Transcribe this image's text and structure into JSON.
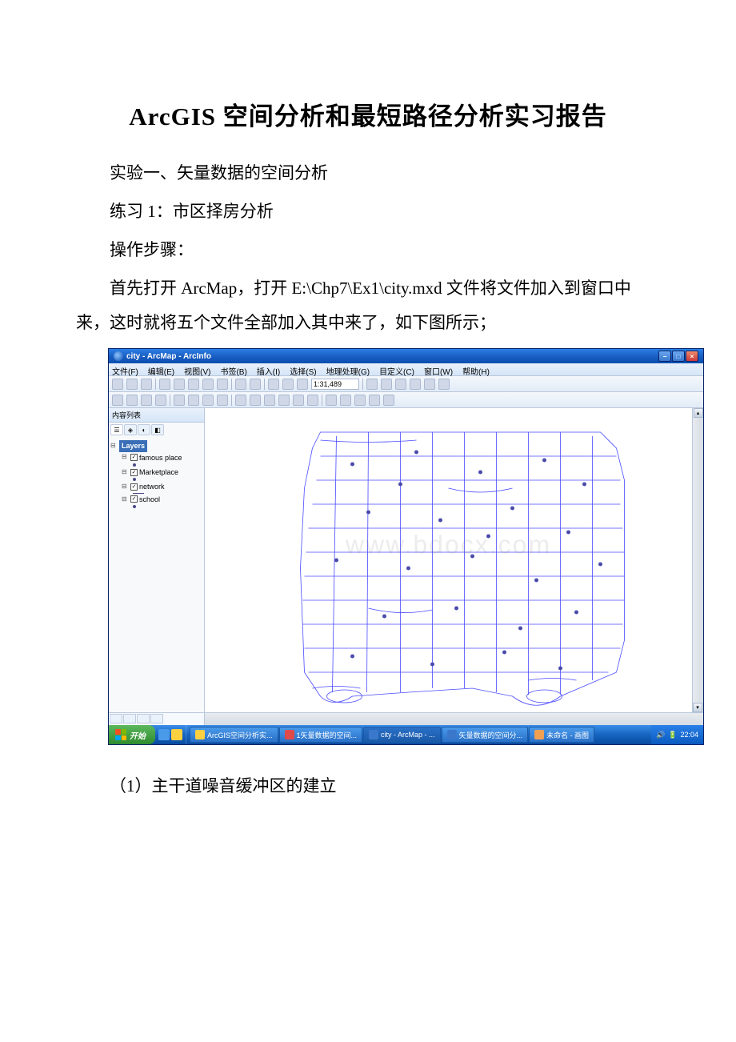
{
  "doc": {
    "title": "ArcGIS 空间分析和最短路径分析实习报告",
    "p1": "实验一、矢量数据的空间分析",
    "p2": "练习 1：市区择房分析",
    "p3": "操作步骤：",
    "p4": "首先打开 ArcMap，打开 E:\\Chp7\\Ex1\\city.mxd 文件将文件加入到窗口中来，这时就将五个文件全部加入其中来了，如下图所示；",
    "p5": "（1）主干道噪音缓冲区的建立"
  },
  "window": {
    "title": "city - ArcMap - ArcInfo",
    "min": "−",
    "max": "□",
    "close": "×"
  },
  "menubar": {
    "items": [
      "文件(F)",
      "编辑(E)",
      "视图(V)",
      "书签(B)",
      "插入(I)",
      "选择(S)",
      "地理处理(G)",
      "目定义(C)",
      "窗口(W)",
      "帮助(H)"
    ]
  },
  "toolbar": {
    "scale": "1:31,489"
  },
  "toc": {
    "header": "内容列表",
    "root": "Layers",
    "layers": [
      {
        "name": "famous place",
        "type": "point"
      },
      {
        "name": "Marketplace",
        "type": "point"
      },
      {
        "name": "network",
        "type": "line"
      },
      {
        "name": "school",
        "type": "point"
      }
    ]
  },
  "watermark": "www.bdocx.com",
  "taskbar": {
    "start": "开始",
    "items": [
      "ArcGIS空间分析实...",
      "1矢量数据的空间...",
      "city - ArcMap - ...",
      "矢量数据的空间分...",
      "未命名 - 画图"
    ],
    "time": "22:04"
  }
}
